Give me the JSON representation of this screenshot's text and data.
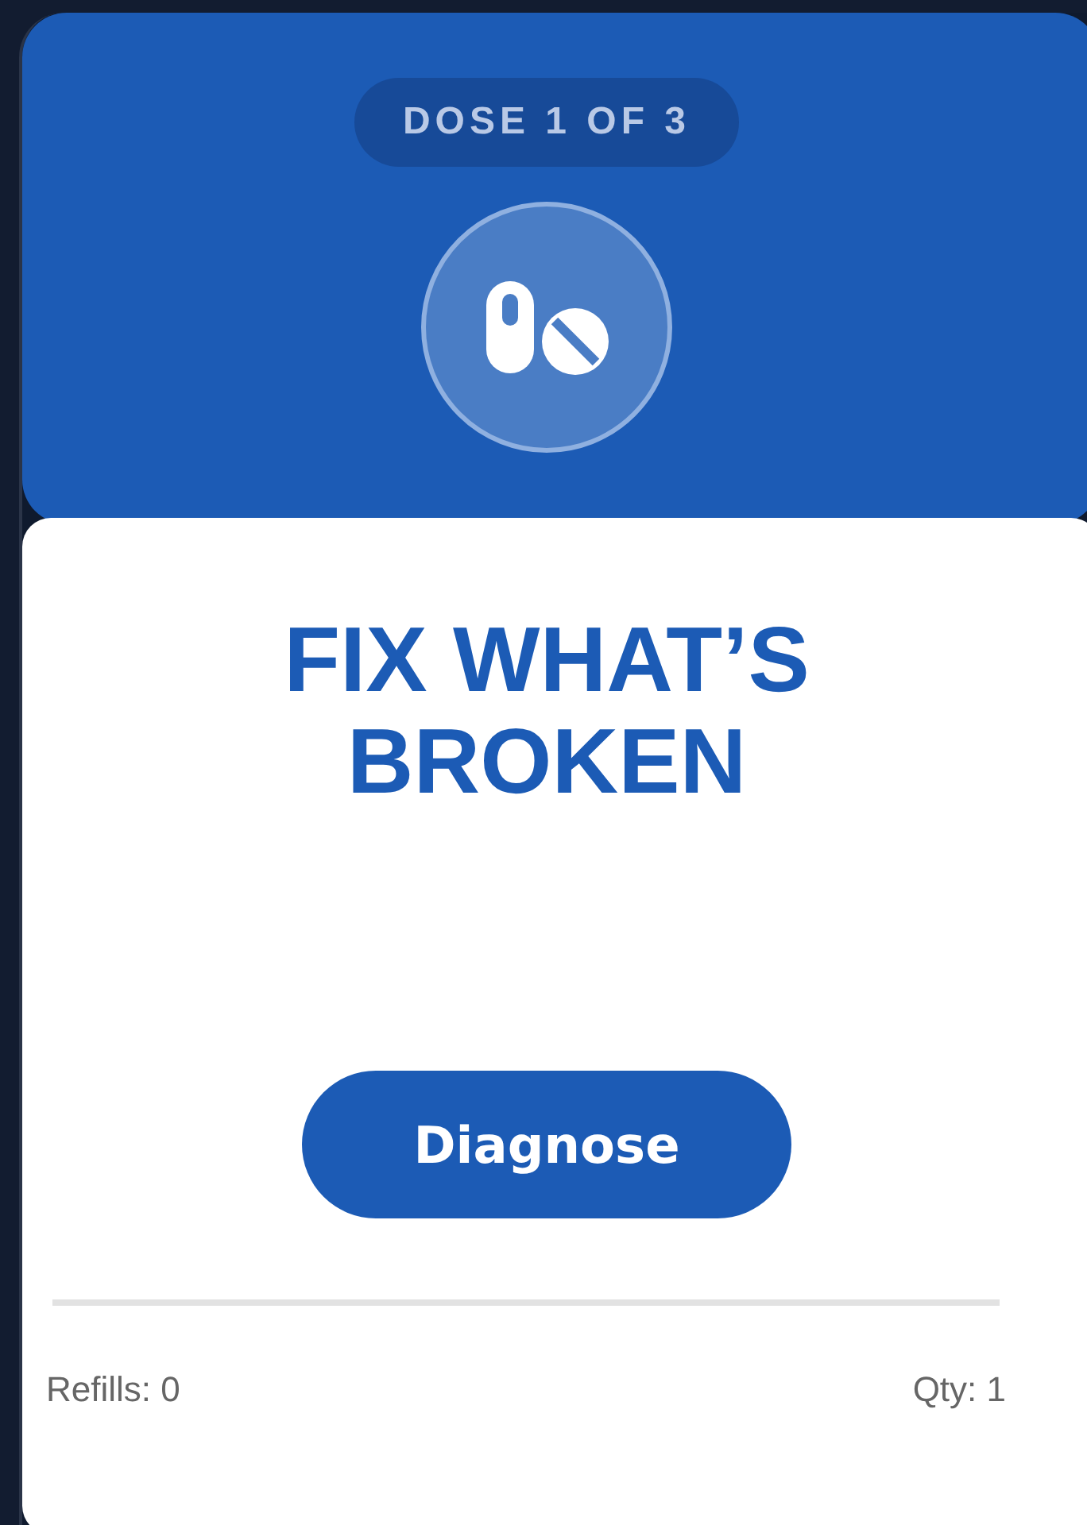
{
  "badge": "DOSE 1 OF 3",
  "title": "FIX WHAT’S BROKEN",
  "button": "Diagnose",
  "footer": {
    "refills": "Refills: 0",
    "quantity": "Qty: 1"
  }
}
